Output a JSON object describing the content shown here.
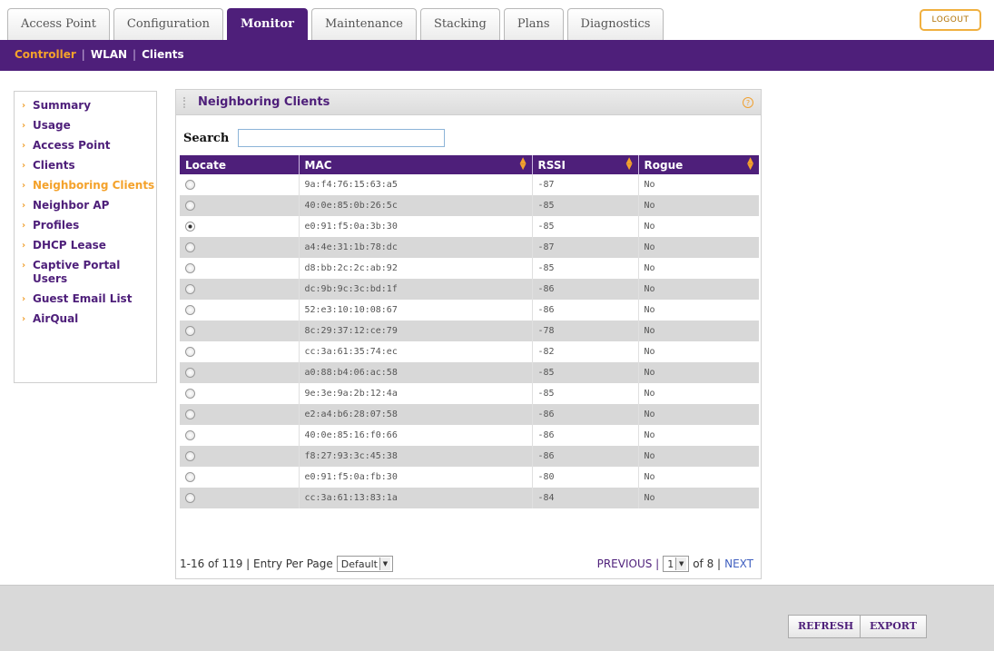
{
  "top_tabs": [
    "Access Point",
    "Configuration",
    "Monitor",
    "Maintenance",
    "Stacking",
    "Plans",
    "Diagnostics"
  ],
  "active_tab": "Monitor",
  "logout_label": "LOGOUT",
  "subnav": {
    "items": [
      "Controller",
      "WLAN",
      "Clients"
    ],
    "active": "Controller"
  },
  "sidebar": {
    "items": [
      {
        "label": "Summary",
        "active": false
      },
      {
        "label": "Usage",
        "active": false
      },
      {
        "label": "Access Point",
        "active": false
      },
      {
        "label": "Clients",
        "active": false
      },
      {
        "label": "Neighboring Clients",
        "active": true
      },
      {
        "label": "Neighbor AP",
        "active": false
      },
      {
        "label": "Profiles",
        "active": false
      },
      {
        "label": "DHCP Lease",
        "active": false
      },
      {
        "label": "Captive Portal Users",
        "active": false
      },
      {
        "label": "Guest Email List",
        "active": false
      },
      {
        "label": "AirQual",
        "active": false
      }
    ]
  },
  "panel": {
    "title": "Neighboring Clients",
    "help_icon": "?",
    "search_label": "Search",
    "search_value": ""
  },
  "table": {
    "columns": [
      "Locate",
      "MAC",
      "RSSI",
      "Rogue"
    ],
    "rows": [
      {
        "selected": false,
        "mac": "9a:f4:76:15:63:a5",
        "rssi": "-87",
        "rogue": "No"
      },
      {
        "selected": false,
        "mac": "40:0e:85:0b:26:5c",
        "rssi": "-85",
        "rogue": "No"
      },
      {
        "selected": true,
        "mac": "e0:91:f5:0a:3b:30",
        "rssi": "-85",
        "rogue": "No"
      },
      {
        "selected": false,
        "mac": "a4:4e:31:1b:78:dc",
        "rssi": "-87",
        "rogue": "No"
      },
      {
        "selected": false,
        "mac": "d8:bb:2c:2c:ab:92",
        "rssi": "-85",
        "rogue": "No"
      },
      {
        "selected": false,
        "mac": "dc:9b:9c:3c:bd:1f",
        "rssi": "-86",
        "rogue": "No"
      },
      {
        "selected": false,
        "mac": "52:e3:10:10:08:67",
        "rssi": "-86",
        "rogue": "No"
      },
      {
        "selected": false,
        "mac": "8c:29:37:12:ce:79",
        "rssi": "-78",
        "rogue": "No"
      },
      {
        "selected": false,
        "mac": "cc:3a:61:35:74:ec",
        "rssi": "-82",
        "rogue": "No"
      },
      {
        "selected": false,
        "mac": "a0:88:b4:06:ac:58",
        "rssi": "-85",
        "rogue": "No"
      },
      {
        "selected": false,
        "mac": "9e:3e:9a:2b:12:4a",
        "rssi": "-85",
        "rogue": "No"
      },
      {
        "selected": false,
        "mac": "e2:a4:b6:28:07:58",
        "rssi": "-86",
        "rogue": "No"
      },
      {
        "selected": false,
        "mac": "40:0e:85:16:f0:66",
        "rssi": "-86",
        "rogue": "No"
      },
      {
        "selected": false,
        "mac": "f8:27:93:3c:45:38",
        "rssi": "-86",
        "rogue": "No"
      },
      {
        "selected": false,
        "mac": "e0:91:f5:0a:fb:30",
        "rssi": "-80",
        "rogue": "No"
      },
      {
        "selected": false,
        "mac": "cc:3a:61:13:83:1a",
        "rssi": "-84",
        "rogue": "No"
      }
    ]
  },
  "pager": {
    "range_text": "1-16 of 119 | Entry Per Page",
    "per_page_value": "Default",
    "previous_label": "PREVIOUS |",
    "page_value": "1",
    "of_text": "of 8 |",
    "next_label": "NEXT"
  },
  "footer": {
    "refresh_label": "REFRESH",
    "export_label": "EXPORT"
  },
  "colors": {
    "purple": "#4e1f7a",
    "orange": "#f4a22b"
  }
}
